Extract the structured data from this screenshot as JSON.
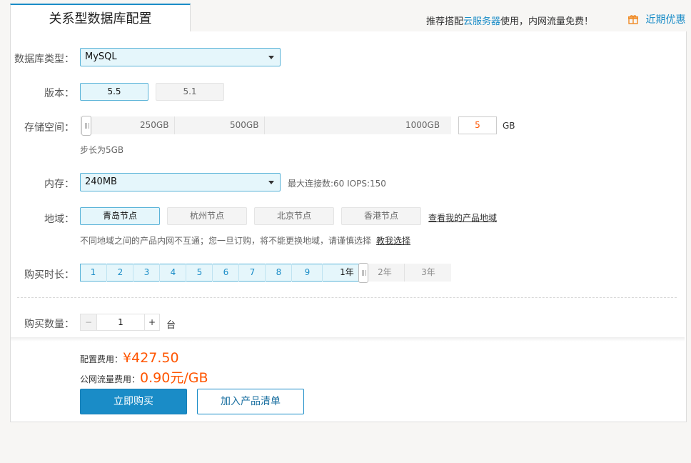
{
  "tabs": {
    "active": "关系型数据库配置"
  },
  "header": {
    "promo_prefix": "推荐搭配",
    "promo_link": "云服务器",
    "promo_suffix": "使用，内网流量免费！",
    "deals_label": "近期优惠"
  },
  "form": {
    "db_type": {
      "label": "数据库类型：",
      "value": "MySQL"
    },
    "version": {
      "label": "版本：",
      "options": [
        "5.5",
        "5.1"
      ],
      "selected": "5.5"
    },
    "storage": {
      "label": "存储空间：",
      "ticks": [
        "250GB",
        "500GB",
        "1000GB"
      ],
      "value": "5",
      "unit": "GB",
      "hint": "步长为5GB",
      "range": [
        5,
        1000
      ]
    },
    "memory": {
      "label": "内存：",
      "value": "240MB",
      "info": "最大连接数:60 IOPS:150"
    },
    "region": {
      "label": "地域：",
      "options": [
        "青岛节点",
        "杭州节点",
        "北京节点",
        "香港节点"
      ],
      "selected": "青岛节点",
      "view_link": "查看我的产品地域",
      "warning": "不同地域之间的产品内网不互通；您一旦订购，将不能更换地域，请谨慎选择",
      "teach_link": "教我选择"
    },
    "duration": {
      "label": "购买时长：",
      "options": [
        "1",
        "2",
        "3",
        "4",
        "5",
        "6",
        "7",
        "8",
        "9",
        "1年",
        "2年",
        "3年"
      ],
      "selected": "1年"
    },
    "quantity": {
      "label": "购买数量：",
      "value": "1",
      "minus": "−",
      "plus": "+",
      "unit": "台"
    }
  },
  "summary": {
    "config_fee_label": "配置费用：",
    "config_fee": "¥427.50",
    "traffic_fee_label": "公网流量费用：",
    "traffic_fee": "0.90元/GB"
  },
  "actions": {
    "buy": "立即购买",
    "add_to_list": "加入产品清单"
  },
  "colors": {
    "accent": "#1a8cc7",
    "price": "#ff5500",
    "selected_bg": "#e5f6fb"
  }
}
